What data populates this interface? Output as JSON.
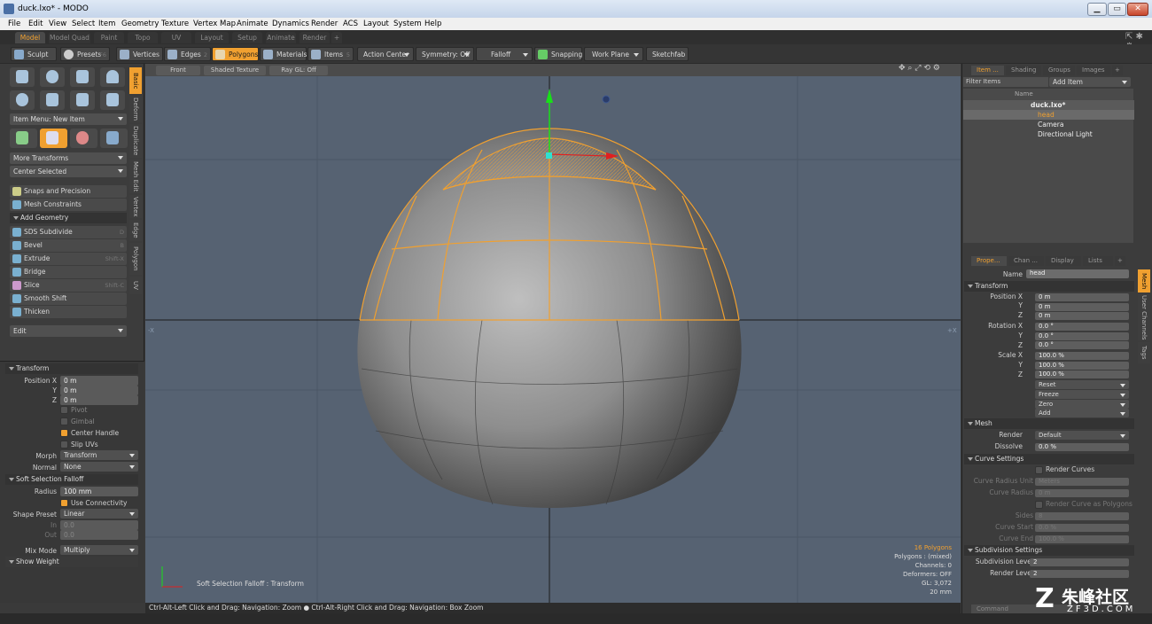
{
  "window": {
    "title": "duck.lxo* - MODO",
    "min": "▁",
    "max": "▭",
    "close": "✕"
  },
  "menu": [
    "File",
    "Edit",
    "View",
    "Select",
    "Item",
    "Geometry",
    "Texture",
    "Vertex Map",
    "Animate",
    "Dynamics",
    "Render",
    "ACS",
    "Layout",
    "System",
    "Help"
  ],
  "tabs": [
    "Model",
    "Model Quad",
    "Paint",
    "Topo",
    "UV",
    "Layout",
    "Setup",
    "Animate",
    "Render",
    "+"
  ],
  "toolbar": {
    "sculpt": "Sculpt",
    "presets": "Presets",
    "presets_key": "F6",
    "vertices": "Vertices",
    "vertices_key": "1",
    "edges": "Edges",
    "edges_key": "2",
    "polygons": "Polygons",
    "materials": "Materials",
    "items": "Items",
    "items_key": "5",
    "action_center": "Action Center",
    "symmetry": "Symmetry: Off",
    "falloff": "Falloff",
    "snapping": "Snapping",
    "work_plane": "Work Plane",
    "sketchfab": "Sketchfab"
  },
  "left": {
    "item_menu": "Item Menu: New Item",
    "more_transforms": "More Transforms",
    "center_selected": "Center Selected",
    "snaps": "Snaps and Precision",
    "mesh_constraints": "Mesh Constraints",
    "add_geometry": "Add Geometry",
    "tools": [
      {
        "label": "SDS Subdivide",
        "key": "D"
      },
      {
        "label": "Bevel",
        "key": "B"
      },
      {
        "label": "Extrude",
        "key": "Shift-X"
      },
      {
        "label": "Bridge",
        "key": ""
      },
      {
        "label": "Slice",
        "key": "Shift-C"
      },
      {
        "label": "Smooth Shift",
        "key": ""
      },
      {
        "label": "Thicken",
        "key": ""
      }
    ],
    "edit": "Edit",
    "vtabs": [
      "Basic",
      "Deform",
      "Duplicate",
      "Mesh Edit",
      "Vertex",
      "Edge",
      "Polygon",
      "UV"
    ],
    "transform_header": "Transform",
    "pos_label": "Position X",
    "y": "Y",
    "z": "Z",
    "pos_x": "0 m",
    "pos_y": "0 m",
    "pos_z": "0 m",
    "pivot": "Pivot",
    "gimbal": "Gimbal",
    "center_handle": "Center Handle",
    "slip_uvs": "Slip UVs",
    "morph_label": "Morph",
    "morph": "Transform",
    "normal_label": "Normal",
    "normal": "None",
    "soft_header": "Soft Selection Falloff",
    "radius_label": "Radius",
    "radius": "100 mm",
    "use_connectivity": "Use Connectivity",
    "shape_label": "Shape Preset",
    "shape": "Linear",
    "in_label": "In",
    "in": "0.0",
    "out_label": "Out",
    "out": "0.0",
    "mix_label": "Mix Mode",
    "mix": "Multiply",
    "show_weight": "Show Weight"
  },
  "viewport": {
    "front": "Front",
    "shaded": "Shaded Texture",
    "raygl": "Ray GL: Off",
    "stats": [
      "16 Polygons",
      "Polygons : (mixed)",
      "Channels: 0",
      "Deformers: OFF",
      "GL: 3,072",
      "20 mm"
    ],
    "tool_label": "Soft Selection Falloff : Transform",
    "minus_x": "-X",
    "plus_x": "+X"
  },
  "status": "Ctrl-Alt-Left Click and Drag: Navigation: Zoom ● Ctrl-Alt-Right Click and Drag: Navigation: Box Zoom",
  "right": {
    "top_tabs": [
      "Item ...",
      "Shading",
      "Groups",
      "Images",
      "+"
    ],
    "filter": "Filter Items",
    "add_item": "Add Item",
    "name_col": "Name",
    "tree": [
      "duck.lxo*",
      "head",
      "Camera",
      "Directional Light"
    ],
    "prop_tabs": [
      "Prope...",
      "Chan ...",
      "Display",
      "Lists",
      "+"
    ],
    "side_tabs": [
      "Mesh",
      "User Channels",
      "Tags"
    ],
    "name_label": "Name",
    "name": "head",
    "transform": "Transform",
    "position_x": "Position X",
    "y": "Y",
    "z": "Z",
    "pos": [
      "0 m",
      "0 m",
      "0 m"
    ],
    "rotation_x": "Rotation X",
    "rot": [
      "0.0 °",
      "0.0 °",
      "0.0 °"
    ],
    "scale_x": "Scale X",
    "scale": [
      "100.0 %",
      "100.0 %",
      "100.0 %"
    ],
    "reset": "Reset",
    "freeze": "Freeze",
    "zero": "Zero",
    "add": "Add",
    "mesh": "Mesh",
    "render_label": "Render",
    "render": "Default",
    "dissolve_label": "Dissolve",
    "dissolve": "0.0 %",
    "curve_settings": "Curve Settings",
    "render_curves": "Render Curves",
    "curve_radius_unit": "Curve Radius Unit",
    "meters": "Meters",
    "curve_radius": "Curve Radius",
    "curve_radius_val": "0 m",
    "render_as_poly": "Render Curve as Polygons",
    "sides": "Sides",
    "sides_val": "8",
    "curve_start": "Curve Start",
    "curve_start_val": "0.0 %",
    "curve_end": "Curve End",
    "curve_end_val": "100.0 %",
    "subdiv_settings": "Subdivision Settings",
    "subdiv_level": "Subdivision Level",
    "subdiv_val": "2",
    "render_level": "Render Level",
    "render_level_val": "2",
    "command": "Command"
  },
  "watermark": {
    "cn": "朱峰社区",
    "url": "ZF3D.COM"
  }
}
